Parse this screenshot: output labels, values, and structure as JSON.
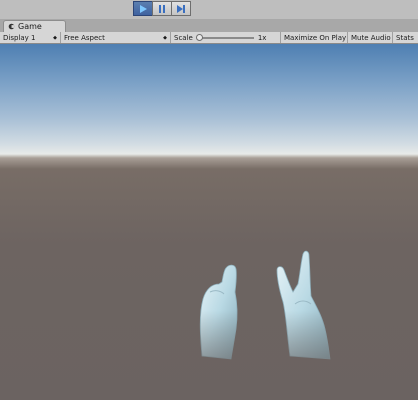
{
  "window": {
    "tab_title": "Game"
  },
  "toolbar": {
    "display": "Display 1",
    "aspect": "Free Aspect",
    "scale_label": "Scale",
    "scale_value": "1x",
    "maximize": "Maximize On Play",
    "mute": "Mute Audio",
    "stats": "Stats",
    "scale_fraction": 0.0
  },
  "playback": {
    "play_icon": "play-icon",
    "pause_icon": "pause-icon",
    "step_icon": "step-icon",
    "active": "play"
  },
  "colors": {
    "play_active": "#3f62a0",
    "sky_top": "#4e7fb2",
    "ground": "#6d6461"
  }
}
